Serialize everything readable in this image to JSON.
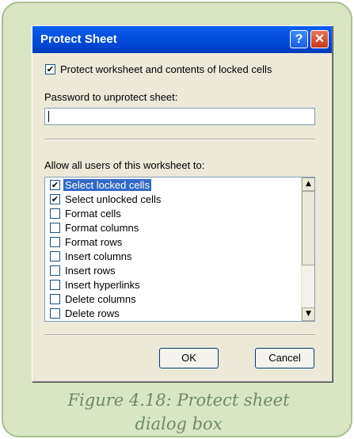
{
  "dialog": {
    "title": "Protect Sheet",
    "help_label": "?",
    "close_label": "✕",
    "protect_checkbox": {
      "checked": true,
      "label": "Protect worksheet and contents of locked cells"
    },
    "password_label": "Password to unprotect sheet:",
    "password_value": "",
    "allow_label": "Allow all users of this worksheet to:",
    "permissions": [
      {
        "label": "Select locked cells",
        "checked": true,
        "selected": true
      },
      {
        "label": "Select unlocked cells",
        "checked": true,
        "selected": false
      },
      {
        "label": "Format cells",
        "checked": false,
        "selected": false
      },
      {
        "label": "Format columns",
        "checked": false,
        "selected": false
      },
      {
        "label": "Format rows",
        "checked": false,
        "selected": false
      },
      {
        "label": "Insert columns",
        "checked": false,
        "selected": false
      },
      {
        "label": "Insert rows",
        "checked": false,
        "selected": false
      },
      {
        "label": "Insert hyperlinks",
        "checked": false,
        "selected": false
      },
      {
        "label": "Delete columns",
        "checked": false,
        "selected": false
      },
      {
        "label": "Delete rows",
        "checked": false,
        "selected": false
      }
    ],
    "ok_label": "OK",
    "cancel_label": "Cancel"
  },
  "caption": {
    "line1": "Figure 4.18: Protect sheet",
    "line2": "dialog box"
  },
  "colors": {
    "frame_bg": "#d9e6c4",
    "titlebar": "#0054e3",
    "selection": "#316ac5",
    "caption_text": "#6d8a6b"
  }
}
